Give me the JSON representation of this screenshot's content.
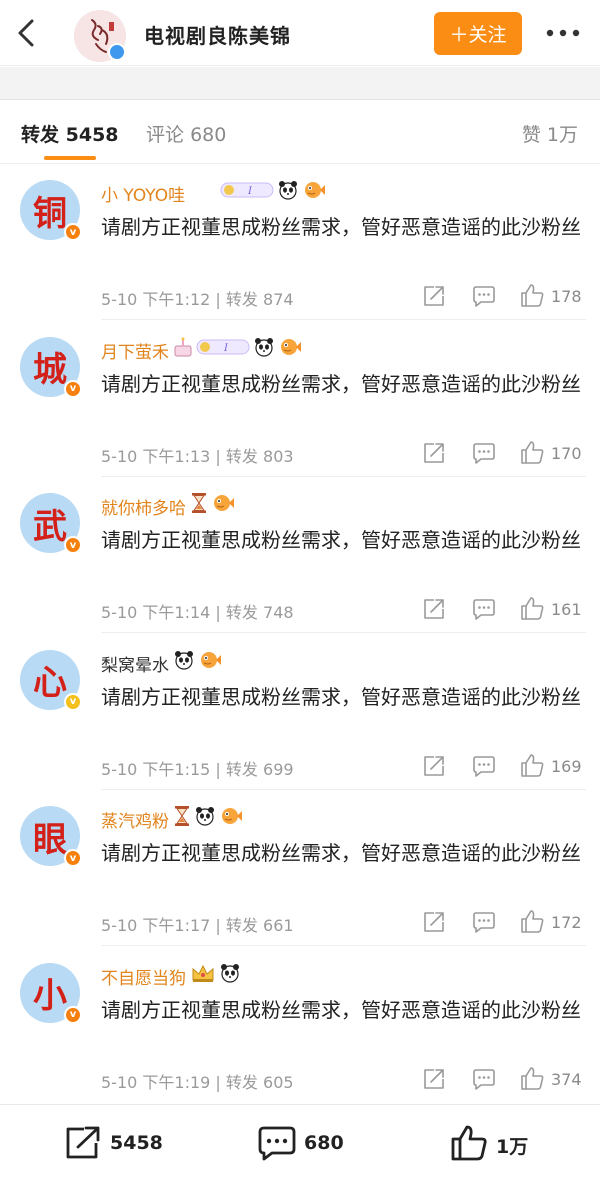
{
  "header": {
    "title": "电视剧良陈美锦",
    "follow_label": "＋关注",
    "avatar_text": "良陈美锦"
  },
  "tabs": {
    "repost_label": "转发",
    "repost_count": "5458",
    "comment_label": "评论",
    "comment_count": "680",
    "like_label": "赞",
    "like_count": "1万"
  },
  "reposts": [
    {
      "avatar_char": "铜",
      "badge": "v",
      "badge_color": "orange",
      "name": "小 YOYO哇",
      "name_colored": true,
      "badges": [
        "vip-card-icon",
        "panda-icon",
        "fish-icon"
      ],
      "text": "请剧方正视董思成粉丝需求，管好恶意造谣的此沙粉丝",
      "time": "5-10 下午1:12",
      "repost_label": "转发",
      "repost_count": "874",
      "likes": "178"
    },
    {
      "avatar_char": "城",
      "badge": "v",
      "badge_color": "orange",
      "name": "月下萤禾",
      "name_colored": true,
      "badges": [
        "cake-icon",
        "vip-card-icon",
        "panda-icon",
        "fish-icon"
      ],
      "text": "请剧方正视董思成粉丝需求，管好恶意造谣的此沙粉丝",
      "time": "5-10 下午1:13",
      "repost_label": "转发",
      "repost_count": "803",
      "likes": "170"
    },
    {
      "avatar_char": "武",
      "badge": "v",
      "badge_color": "orange",
      "name": "就你柿多哈",
      "name_colored": true,
      "badges": [
        "hourglass-icon",
        "fish-icon"
      ],
      "text": "请剧方正视董思成粉丝需求，管好恶意造谣的此沙粉丝",
      "time": "5-10 下午1:14",
      "repost_label": "转发",
      "repost_count": "748",
      "likes": "161"
    },
    {
      "avatar_char": "心",
      "badge": "v",
      "badge_color": "yellow",
      "name": "梨窝晕水",
      "name_colored": false,
      "badges": [
        "panda-icon",
        "fish-icon"
      ],
      "text": "请剧方正视董思成粉丝需求，管好恶意造谣的此沙粉丝",
      "time": "5-10 下午1:15",
      "repost_label": "转发",
      "repost_count": "699",
      "likes": "169"
    },
    {
      "avatar_char": "眼",
      "badge": "v",
      "badge_color": "orange",
      "name": "蒸汽鸡粉",
      "name_colored": true,
      "badges": [
        "hourglass-icon",
        "panda-icon",
        "fish-icon"
      ],
      "text": "请剧方正视董思成粉丝需求，管好恶意造谣的此沙粉丝",
      "time": "5-10 下午1:17",
      "repost_label": "转发",
      "repost_count": "661",
      "likes": "172"
    },
    {
      "avatar_char": "小",
      "badge": "v",
      "badge_color": "orange",
      "name": "不自愿当狗",
      "name_colored": true,
      "badges": [
        "crown-icon",
        "panda-icon"
      ],
      "text": "请剧方正视董思成粉丝需求，管好恶意造谣的此沙粉丝",
      "time": "5-10 下午1:19",
      "repost_label": "转发",
      "repost_count": "605",
      "likes": "374"
    }
  ],
  "bottom_bar": {
    "repost_count": "5458",
    "comment_count": "680",
    "like_count": "1万"
  },
  "colors": {
    "accent": "#fb8d14",
    "username": "#e2841c",
    "avatar_bg": "#b9daf4",
    "avatar_char": "#d3211a"
  }
}
